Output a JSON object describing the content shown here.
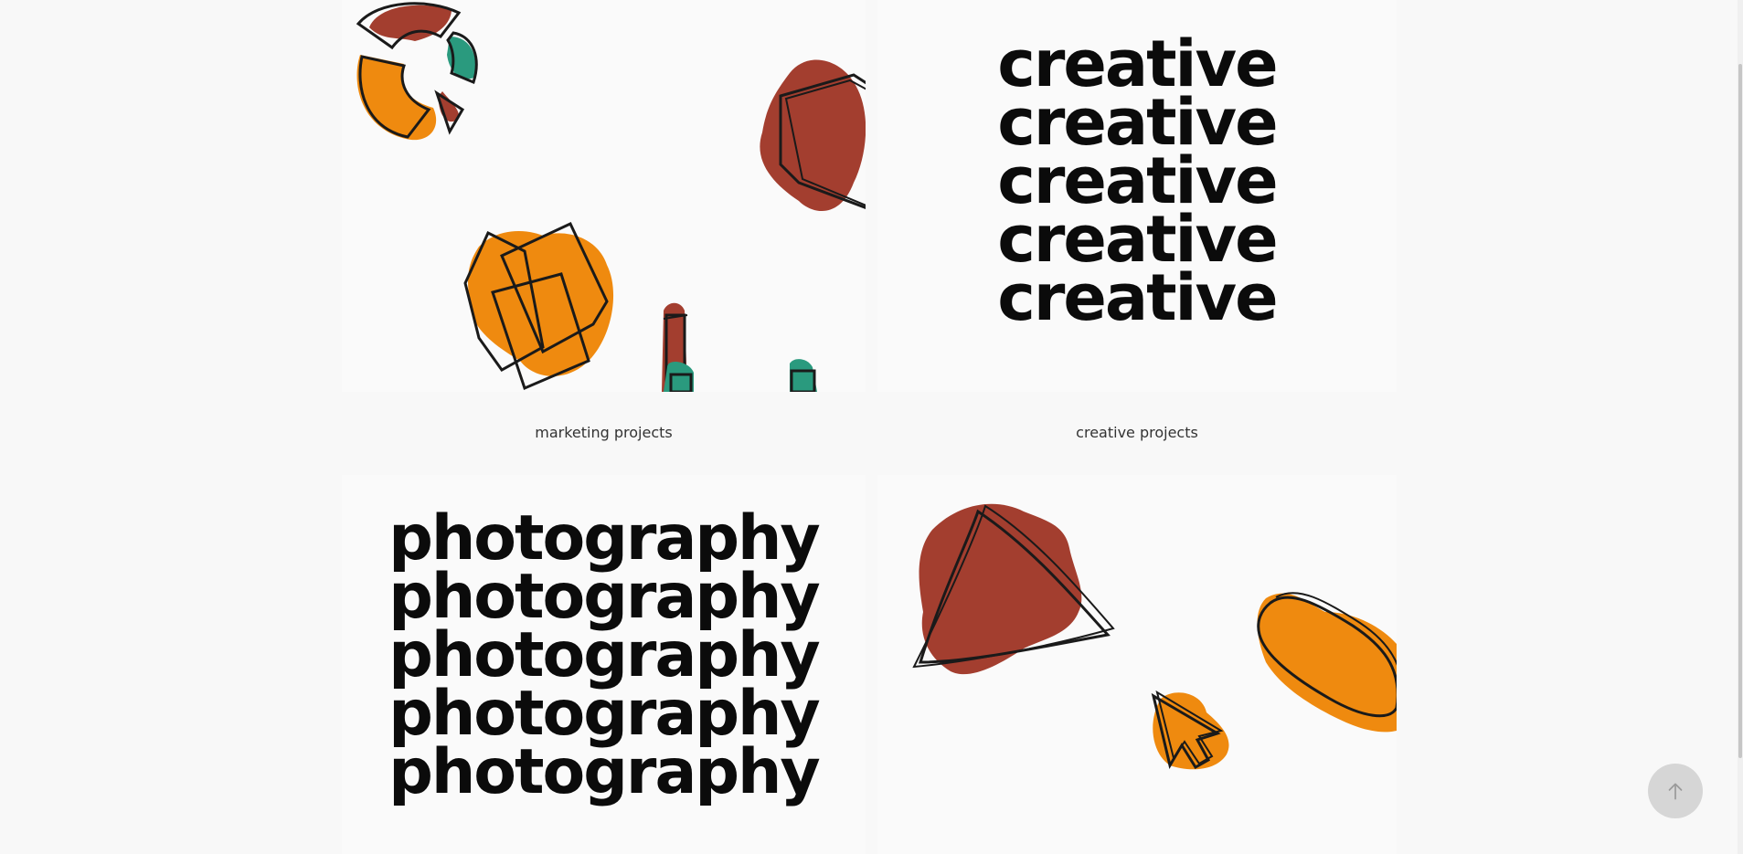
{
  "gallery": {
    "tiles": [
      {
        "caption": "marketing projects"
      },
      {
        "caption": "creative projects",
        "words": [
          "creative",
          "creative",
          "creative",
          "creative",
          "creative"
        ]
      },
      {
        "words": [
          "photography",
          "photography",
          "photography",
          "photography",
          "photography"
        ]
      },
      {}
    ]
  },
  "colors": {
    "brick": "#a33e2f",
    "orange": "#ef8a0f",
    "teal": "#2a9a7e",
    "outline": "#1a1a1a"
  },
  "back_to_top": {
    "icon": "arrow-up-icon"
  }
}
